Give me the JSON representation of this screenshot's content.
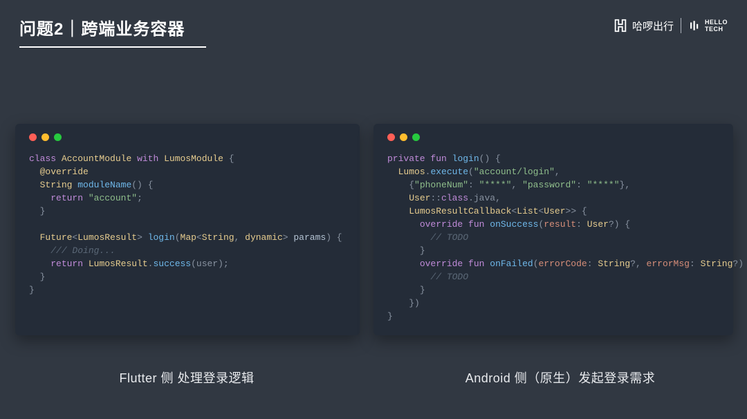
{
  "header": {
    "title": "问题2｜跨端业务容器",
    "brand1": "哈啰出行",
    "brand2_line1": "HELLO",
    "brand2_line2": "TECH"
  },
  "panels": {
    "left": {
      "caption": "Flutter 侧 处理登录逻辑",
      "code": {
        "l1_class": "class",
        "l1_name": "AccountModule",
        "l1_with": "with",
        "l1_mixin": "LumosModule",
        "l1_brace": " {",
        "l2_ann": "@override",
        "l3_type": "String",
        "l3_fn": "moduleName",
        "l3_sig": "() {",
        "l4_return": "return",
        "l4_str": "\"account\"",
        "l4_semi": ";",
        "l5_close": "}",
        "l7_type": "Future",
        "l7_gstart": "<",
        "l7_gtype": "LumosResult",
        "l7_gend": ">",
        "l7_fn": "login",
        "l7_popen": "(",
        "l7_ptype": "Map",
        "l7_pgstart": "<",
        "l7_pk": "String",
        "l7_pcomma": ", ",
        "l7_pv": "dynamic",
        "l7_pgend": ">",
        "l7_pname": " params",
        "l7_pclose": ") {",
        "l8_cmt": "/// Doing...",
        "l9_return": "return",
        "l9_cls": "LumosResult",
        "l9_dot": ".",
        "l9_fn": "success",
        "l9_args": "(user);",
        "l10_close": "}",
        "l11_close": "}"
      }
    },
    "right": {
      "caption": "Android 侧（原生）发起登录需求",
      "code": {
        "l1_private": "private",
        "l1_fun": "fun",
        "l1_fn": "login",
        "l1_sig": "() {",
        "l2_cls": "Lumos",
        "l2_dot": ".",
        "l2_fn": "execute",
        "l2_open": "(",
        "l2_str": "\"account/login\"",
        "l2_comma": ",",
        "l3_open": "{",
        "l3_k1": "\"phoneNum\"",
        "l3_c1": ": ",
        "l3_v1": "\"****\"",
        "l3_comma": ", ",
        "l3_k2": "\"password\"",
        "l3_c2": ": ",
        "l3_v2": "\"****\"",
        "l3_close": "},",
        "l4_user": "User",
        "l4_dcolon": "::",
        "l4_class": "class",
        "l4_java": ".java,",
        "l5_cls": "LumosResultCallback",
        "l5_gstart": "<",
        "l5_list": "List",
        "l5_gstart2": "<",
        "l5_user": "User",
        "l5_gend": ">> {",
        "l6_override": "override",
        "l6_fun": "fun",
        "l6_fn": "onSuccess",
        "l6_open": "(",
        "l6_pname": "result",
        "l6_colon": ": ",
        "l6_ptype": "User",
        "l6_q": "?) {",
        "l7_cmt": "// TODO",
        "l8_close": "}",
        "l9_override": "override",
        "l9_fun": "fun",
        "l9_fn": "onFailed",
        "l9_open": "(",
        "l9_p1": "errorCode",
        "l9_c1": ": ",
        "l9_t1": "String",
        "l9_q1": "?, ",
        "l9_p2": "errorMsg",
        "l9_c2": ": ",
        "l9_t2": "String",
        "l9_q2": "?) {",
        "l10_cmt": "// TODO",
        "l11_close": "}",
        "l12_close": "})",
        "l13_close": "}"
      }
    }
  }
}
